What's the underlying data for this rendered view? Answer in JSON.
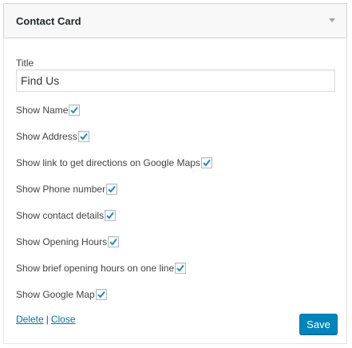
{
  "widget": {
    "title": "Contact Card",
    "toggle_icon": "triangle-down-icon"
  },
  "form": {
    "title_label": "Title",
    "title_value": "Find Us",
    "options": [
      {
        "label": "Show Name",
        "checked": true
      },
      {
        "label": "Show Address",
        "checked": true
      },
      {
        "label": "Show link to get directions on Google Maps",
        "checked": true
      },
      {
        "label": "Show Phone number",
        "checked": true
      },
      {
        "label": "Show contact details",
        "checked": true
      },
      {
        "label": "Show Opening Hours",
        "checked": true
      },
      {
        "label": "Show brief opening hours on one line",
        "checked": true
      },
      {
        "label": "Show Google Map",
        "checked": true
      }
    ]
  },
  "footer": {
    "delete_label": "Delete",
    "separator": "|",
    "close_label": "Close",
    "save_label": "Save"
  },
  "colors": {
    "link": "#0073aa",
    "save_button": "#0085ba",
    "check_mark": "#1e8cbe"
  }
}
